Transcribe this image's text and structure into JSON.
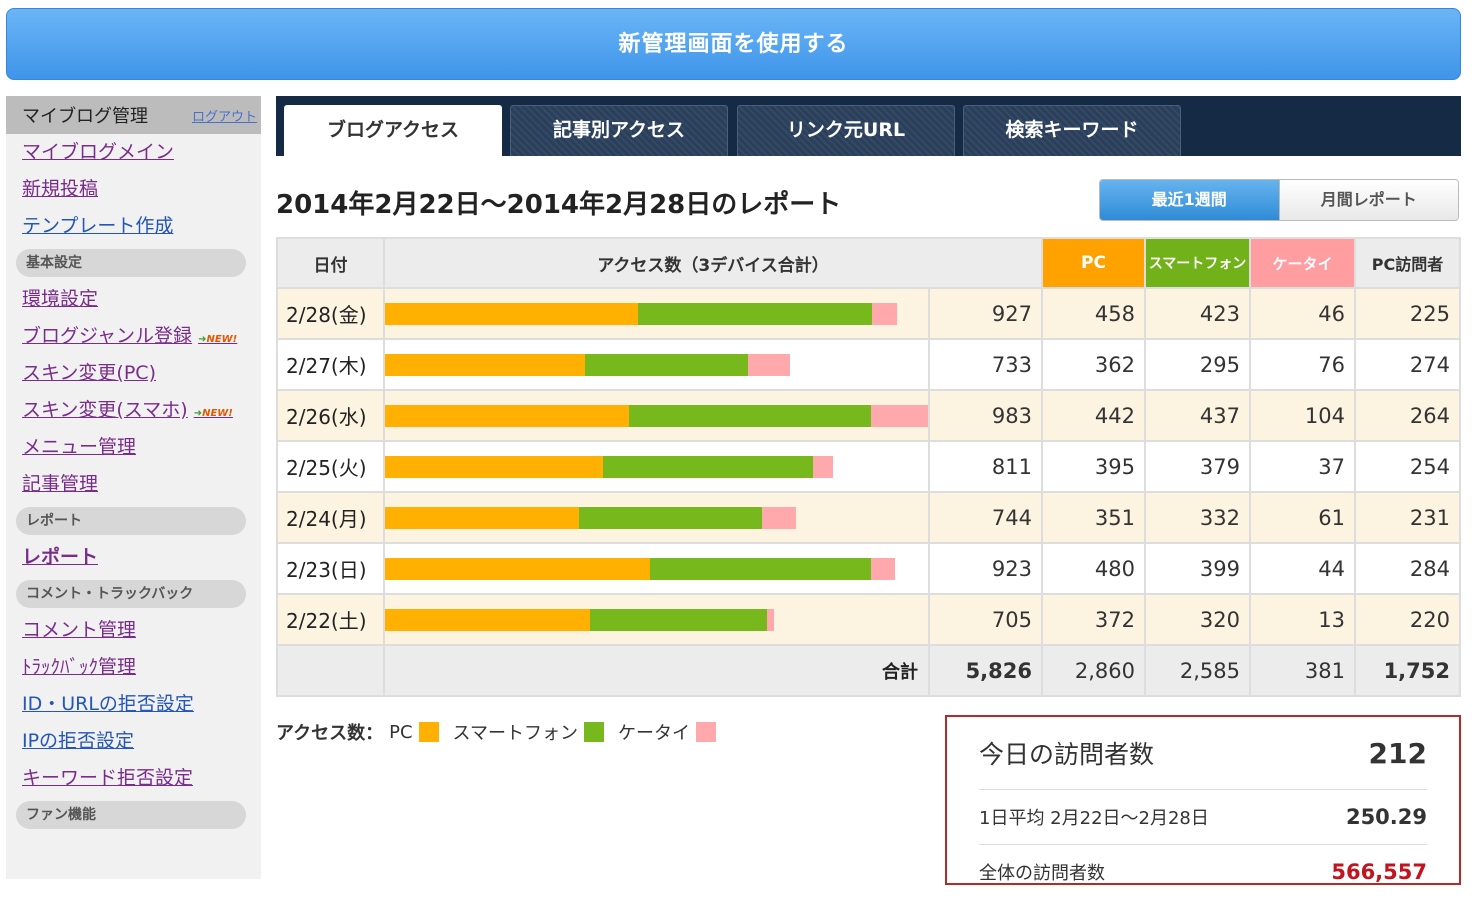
{
  "banner": {
    "label": "新管理画面を使用する"
  },
  "sidebar": {
    "title": "マイブログ管理",
    "logout": "ログアウト",
    "groups": [
      {
        "items": [
          "マイブログメイン",
          "新規投稿",
          "テンプレート作成"
        ]
      },
      {
        "section": "基本設定",
        "items": [
          "環境設定",
          "ブログジャンル登録",
          "スキン変更(PC)",
          "スキン変更(スマホ)",
          "メニュー管理",
          "記事管理"
        ]
      },
      {
        "section": "レポート",
        "items": [
          "レポート"
        ]
      },
      {
        "section": "コメント・トラックバック",
        "items": [
          "コメント管理",
          "ﾄﾗｯｸﾊﾞｯｸ管理",
          "ID・URLの拒否設定",
          "IPの拒否設定",
          "キーワード拒否設定"
        ]
      },
      {
        "section": "ファン機能",
        "items": []
      }
    ],
    "new_badge": "NEW!"
  },
  "tabs": [
    "ブログアクセス",
    "記事別アクセス",
    "リンク元URL",
    "検索キーワード"
  ],
  "report": {
    "title": "2014年2月22日〜2014年2月28日のレポート",
    "range_buttons": [
      "最近1週間",
      "月間レポート"
    ]
  },
  "table": {
    "headers": {
      "date": "日付",
      "access": "アクセス数（3デバイス合計）",
      "pc": "PC",
      "sp": "スマートフォン",
      "kt": "ケータイ",
      "visitors": "PC訪問者"
    },
    "rows": [
      {
        "date": "2/28(金)",
        "total": "927",
        "pc": "458",
        "sp": "423",
        "kt": "46",
        "visitors": "225"
      },
      {
        "date": "2/27(木)",
        "total": "733",
        "pc": "362",
        "sp": "295",
        "kt": "76",
        "visitors": "274"
      },
      {
        "date": "2/26(水)",
        "total": "983",
        "pc": "442",
        "sp": "437",
        "kt": "104",
        "visitors": "264"
      },
      {
        "date": "2/25(火)",
        "total": "811",
        "pc": "395",
        "sp": "379",
        "kt": "37",
        "visitors": "254"
      },
      {
        "date": "2/24(月)",
        "total": "744",
        "pc": "351",
        "sp": "332",
        "kt": "61",
        "visitors": "231"
      },
      {
        "date": "2/23(日)",
        "total": "923",
        "pc": "480",
        "sp": "399",
        "kt": "44",
        "visitors": "284"
      },
      {
        "date": "2/22(土)",
        "total": "705",
        "pc": "372",
        "sp": "320",
        "kt": "13",
        "visitors": "220"
      }
    ],
    "total": {
      "label": "合計",
      "total": "5,826",
      "pc": "2,860",
      "sp": "2,585",
      "kt": "381",
      "visitors": "1,752"
    },
    "max_access": 983
  },
  "legend": {
    "label": "アクセス数：",
    "pc": "PC",
    "sp": "スマートフォン",
    "kt": "ケータイ"
  },
  "colors": {
    "pc": "#ffb000",
    "sp": "#77b81c",
    "kt": "#ffa9ad",
    "accent": "#3f95ea",
    "highlight": "#c0141e"
  },
  "visitors": {
    "today_label": "今日の訪問者数",
    "today": "212",
    "avg_label": "1日平均 2月22日〜2月28日",
    "avg": "250.29",
    "all_label": "全体の訪問者数",
    "all": "566,557"
  }
}
